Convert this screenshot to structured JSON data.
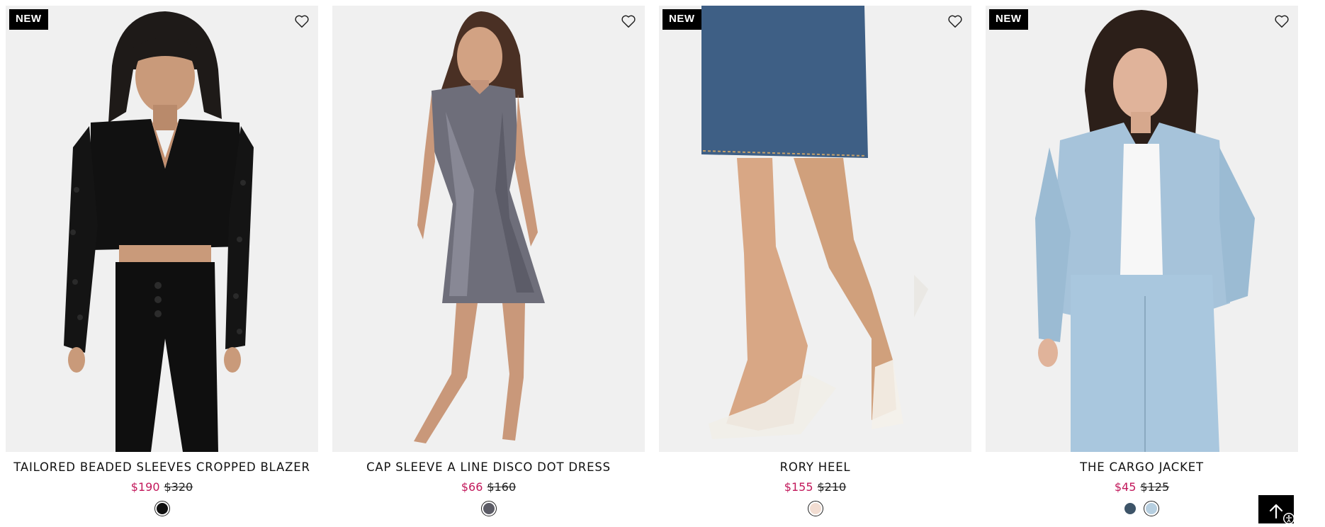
{
  "products": [
    {
      "badge": "NEW",
      "title": "TAILORED BEADED SLEEVES CROPPED BLAZER",
      "sale_price": "$190",
      "original_price": "$320",
      "swatches": [
        {
          "color": "#111111",
          "selected": true
        }
      ]
    },
    {
      "badge": "",
      "title": "CAP SLEEVE A LINE DISCO DOT DRESS",
      "sale_price": "$66",
      "original_price": "$160",
      "swatches": [
        {
          "color": "#5c5c66",
          "selected": true
        }
      ]
    },
    {
      "badge": "NEW",
      "title": "RORY HEEL",
      "sale_price": "$155",
      "original_price": "$210",
      "swatches": [
        {
          "color": "#f2ddd2",
          "selected": true
        }
      ]
    },
    {
      "badge": "NEW",
      "title": "THE CARGO JACKET",
      "sale_price": "$45",
      "original_price": "$125",
      "swatches": [
        {
          "color": "#3d5468",
          "selected": false
        },
        {
          "color": "#b7cfe0",
          "selected": true
        }
      ]
    }
  ],
  "icons": {
    "wishlist": "heart-outline-icon",
    "back_to_top": "arrow-up-icon",
    "accessibility": "accessibility-icon"
  },
  "colors": {
    "sale": "#c2185b",
    "badge_bg": "#000000",
    "image_bg": "#f0f0f0"
  }
}
